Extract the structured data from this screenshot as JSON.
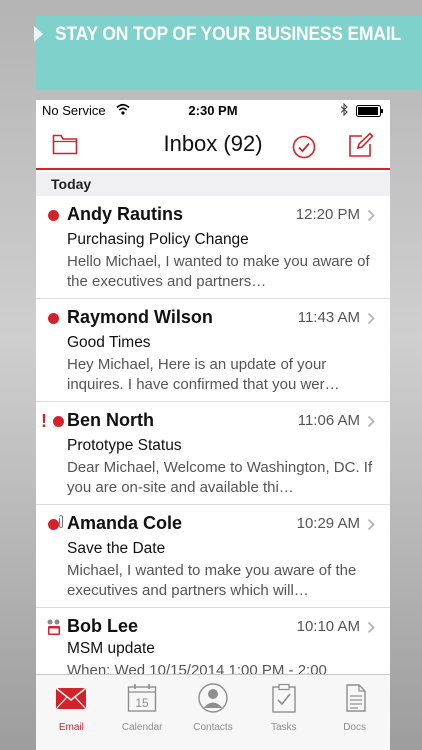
{
  "banner": {
    "text": "STAY ON TOP OF YOUR BUSINESS EMAIL"
  },
  "status_bar": {
    "carrier": "No Service",
    "time": "2:30 PM"
  },
  "nav": {
    "title": "Inbox (92)"
  },
  "section": {
    "label": "Today"
  },
  "messages": [
    {
      "sender": "Andy Rautins",
      "time": "12:20 PM",
      "subject": "Purchasing Policy Change",
      "preview": "Hello Michael, I wanted to make you aware of the executives and partners…"
    },
    {
      "sender": "Raymond Wilson",
      "time": "11:43 AM",
      "subject": "Good Times",
      "preview": "Hey Michael, Here is an update of your inquires. I have confirmed that you wer…"
    },
    {
      "sender": "Ben North",
      "time": "11:06 AM",
      "subject": "Prototype Status",
      "preview": "Dear Michael, Welcome to Washington, DC. If you are on-site and available thi…"
    },
    {
      "sender": "Amanda Cole",
      "time": "10:29 AM",
      "subject": "Save the Date",
      "preview": "Michael, I wanted to make you aware of the executives and partners which will…"
    },
    {
      "sender": "Bob Lee",
      "time": "10:10 AM",
      "subject": "MSM update",
      "preview": "When: Wed 10/15/2014 1:00 PM - 2:00"
    }
  ],
  "tabs": [
    {
      "label": "Email",
      "active": true
    },
    {
      "label": "Calendar",
      "day": "15"
    },
    {
      "label": "Contacts"
    },
    {
      "label": "Tasks"
    },
    {
      "label": "Docs"
    }
  ],
  "colors": {
    "accent": "#d2232a",
    "banner": "#7fd1cb"
  }
}
